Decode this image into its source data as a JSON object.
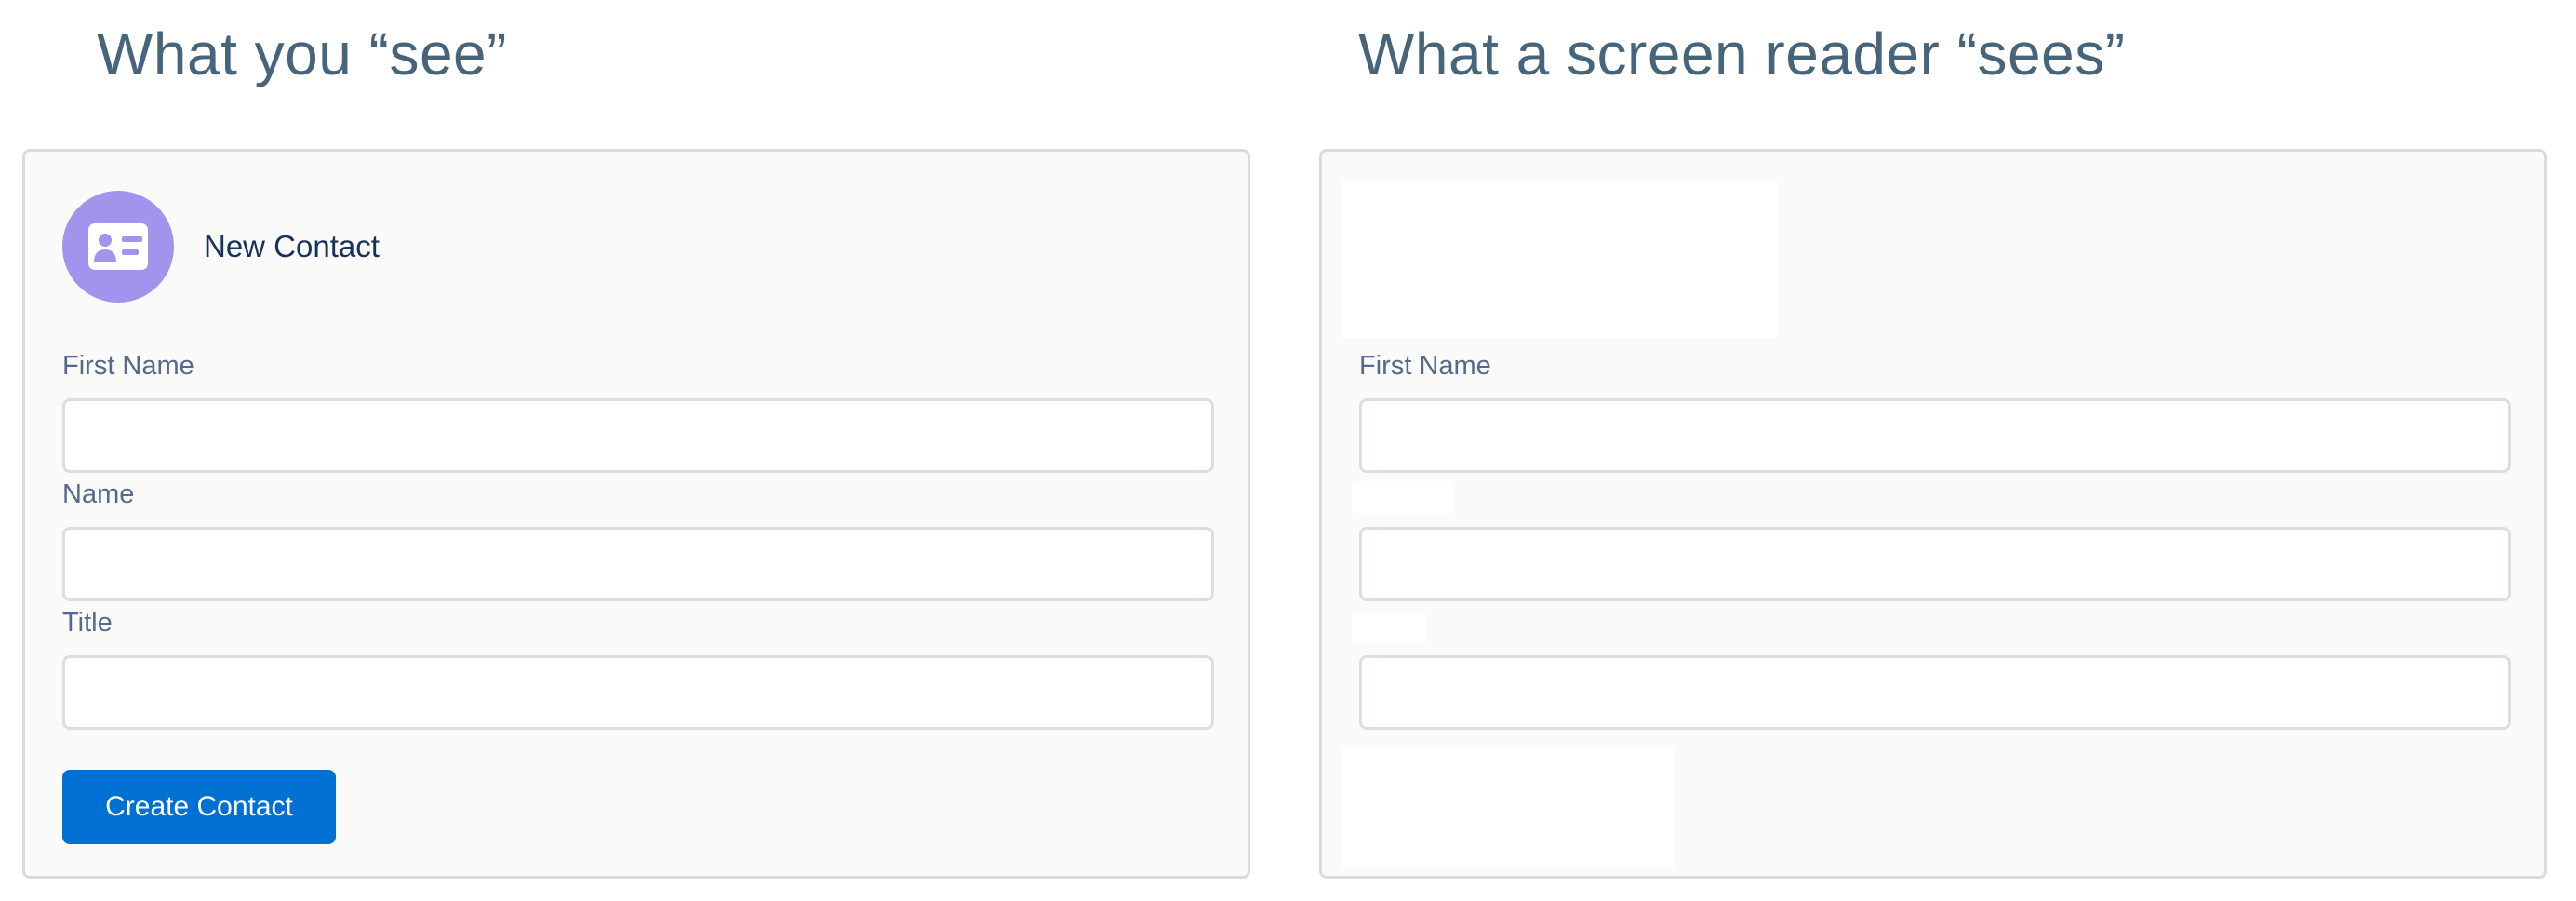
{
  "left": {
    "heading": "What you “see”",
    "card": {
      "icon": "contact-card-icon",
      "title": "New Contact"
    },
    "fields": [
      {
        "label": "First Name",
        "value": ""
      },
      {
        "label": "Name",
        "value": ""
      },
      {
        "label": "Title",
        "value": ""
      }
    ],
    "submit_label": "Create Contact"
  },
  "right": {
    "heading": "What a screen reader “sees”",
    "fields": [
      {
        "label": "First Name",
        "value": ""
      },
      {
        "value": ""
      },
      {
        "value": ""
      }
    ]
  },
  "colors": {
    "heading": "#46657a",
    "avatar": "#a094ed",
    "button": "#0070d2",
    "label": "#54698d",
    "border": "#dddbda"
  }
}
